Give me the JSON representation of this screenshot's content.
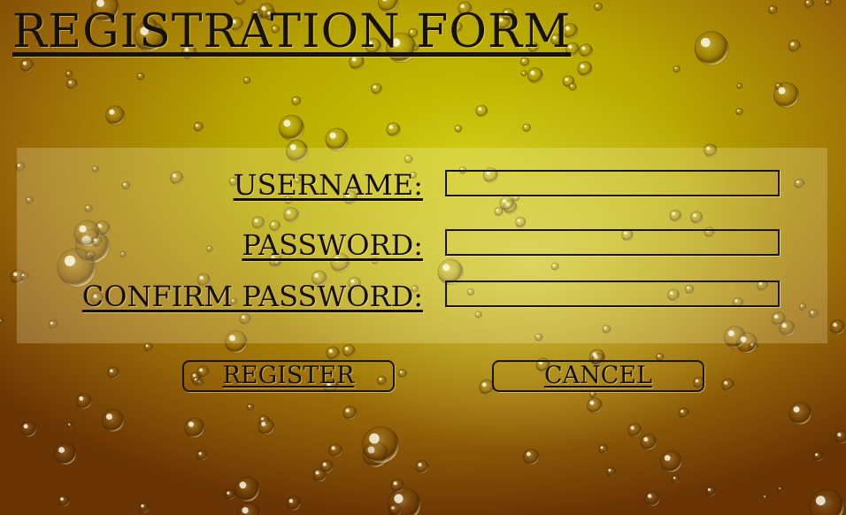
{
  "page": {
    "title": "Registration Form"
  },
  "form": {
    "username_label": "Username:",
    "password_label": "Password:",
    "confirm_label": "Confirm Password:",
    "username_value": "",
    "password_value": "",
    "confirm_value": ""
  },
  "buttons": {
    "register_label": "Register",
    "cancel_label": "Cancel"
  },
  "colors": {
    "background_center": "#c9c400",
    "background_edge": "#6a3404",
    "text": "#141008",
    "panel": "rgba(255,255,215,0.22)"
  }
}
